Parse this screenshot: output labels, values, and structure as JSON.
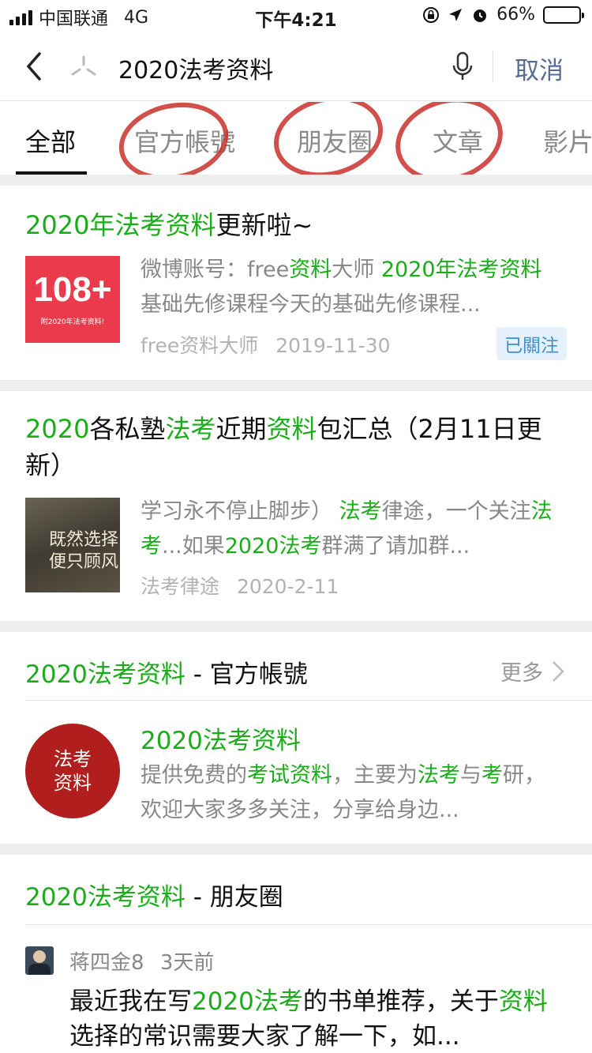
{
  "status": {
    "carrier": "中国联通",
    "network": "4G",
    "time": "下午4:21",
    "battery": "66%",
    "battery_level": 0.66
  },
  "search": {
    "query": "2020法考资料",
    "cancel_label": "取消"
  },
  "tabs": [
    {
      "label": "全部"
    },
    {
      "label": "官方帳號"
    },
    {
      "label": "朋友圈"
    },
    {
      "label": "文章"
    },
    {
      "label": "影片"
    }
  ],
  "articles": [
    {
      "title": [
        {
          "t": "2020年法考资料",
          "hl": true
        },
        {
          "t": "更新啦~",
          "hl": false
        }
      ],
      "thumb_text": "108+",
      "thumb_sub": "附2020年法考资料!",
      "snippet": [
        {
          "t": "微博账号：free",
          "hl": false
        },
        {
          "t": "资料",
          "hl": true
        },
        {
          "t": "大师 ",
          "hl": false
        },
        {
          "t": "2020年法考资料",
          "hl": true
        },
        {
          "t": " 基础先修课程今天的基础先修课程...",
          "hl": false
        }
      ],
      "source": "free资料大师",
      "date": "2019-11-30",
      "badge": "已關注"
    },
    {
      "title": [
        {
          "t": "2020",
          "hl": true
        },
        {
          "t": "各私塾",
          "hl": false
        },
        {
          "t": "法考",
          "hl": true
        },
        {
          "t": "近期",
          "hl": false
        },
        {
          "t": "资料",
          "hl": true
        },
        {
          "t": "包汇总（2月11日更新）",
          "hl": false
        }
      ],
      "thumb_text": "既然选择\n便只顾风",
      "snippet": [
        {
          "t": "学习永不停止脚步） ",
          "hl": false
        },
        {
          "t": "法考",
          "hl": true
        },
        {
          "t": "律途，一个关注",
          "hl": false
        },
        {
          "t": "法考",
          "hl": true
        },
        {
          "t": "...如果",
          "hl": false
        },
        {
          "t": "2020法考",
          "hl": true
        },
        {
          "t": "群满了请加群...",
          "hl": false
        }
      ],
      "source": "法考律途",
      "date": "2020-2-11"
    }
  ],
  "official_section": {
    "title_hl": "2020法考资料",
    "title_rest": " - 官方帳號",
    "more_label": "更多",
    "account": {
      "logo_text": "法考\n资料",
      "name": "2020法考资料",
      "desc": [
        {
          "t": "提供免费的",
          "hl": false
        },
        {
          "t": "考试资料",
          "hl": true
        },
        {
          "t": "，主要为",
          "hl": false
        },
        {
          "t": "法考",
          "hl": true
        },
        {
          "t": "与",
          "hl": false
        },
        {
          "t": "考",
          "hl": true
        },
        {
          "t": "研，欢迎大家多多关注，分享给身边...",
          "hl": false
        }
      ]
    }
  },
  "moments_section": {
    "title_hl": "2020法考资料",
    "title_rest": " - 朋友圈",
    "post": {
      "author": "蒋四金8",
      "time": "3天前",
      "text": [
        {
          "t": "最近我在写",
          "hl": false
        },
        {
          "t": "2020法考",
          "hl": true
        },
        {
          "t": "的书单推荐，关于",
          "hl": false
        },
        {
          "t": "资料",
          "hl": true
        },
        {
          "t": "选择的常识需要大家了解一下，如...",
          "hl": false
        }
      ]
    }
  },
  "colors": {
    "highlight": "#1aad19",
    "link_blue": "#576b95",
    "annotation_red": "#c9312b"
  },
  "icons": [
    "back-chevron-icon",
    "search-spark-icon",
    "microphone-icon",
    "chevron-right-icon",
    "signal-icon",
    "location-arrow-icon",
    "alarm-icon",
    "lock-rotation-icon",
    "battery-icon"
  ]
}
